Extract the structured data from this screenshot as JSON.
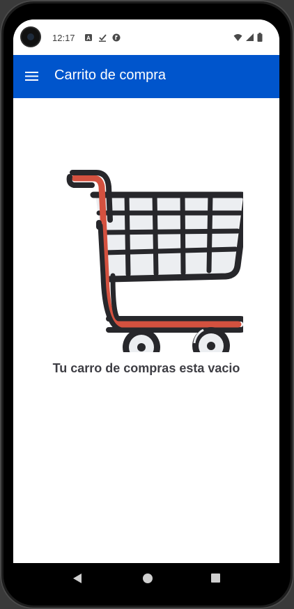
{
  "status_bar": {
    "time": "12:17",
    "icons": [
      "text-a-icon",
      "download-done-icon",
      "app-badge-icon"
    ],
    "system_icons": [
      "wifi-icon",
      "signal-icon",
      "battery-icon"
    ]
  },
  "app_bar": {
    "title": "Carrito de compra",
    "menu_icon": "hamburger-menu-icon",
    "color": "#0055cc"
  },
  "main": {
    "illustration": "shopping-cart-icon",
    "empty_message": "Tu carro de compras esta vacio"
  },
  "nav_bar": {
    "buttons": [
      "back-icon",
      "home-icon",
      "recents-icon"
    ]
  },
  "colors": {
    "cart_frame": "#27272b",
    "cart_handle": "#d4513f",
    "cart_grid": "#eceef1",
    "text": "#3e3e44"
  }
}
